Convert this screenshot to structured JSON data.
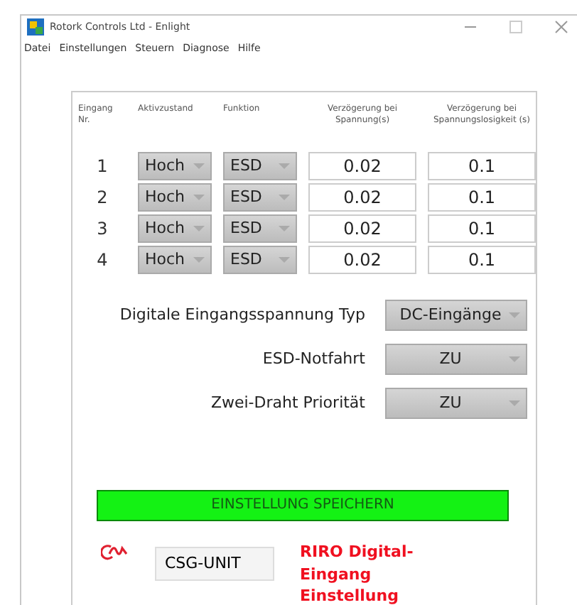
{
  "window": {
    "title": "Rotork Controls Ltd - Enlight"
  },
  "menu": [
    "Datei",
    "Einstellungen",
    "Steuern",
    "Diagnose",
    "Hilfe"
  ],
  "table": {
    "columns": [
      "Eingang Nr.",
      "Aktivzustand",
      "Funktion",
      "Verzögerung bei Spannung(s)",
      "Verzögerung bei Spannungslosigkeit (s)"
    ],
    "rows": [
      {
        "number": "1",
        "state": "Hoch",
        "function": "ESD",
        "delay_on": "0.02",
        "delay_off": "0.1"
      },
      {
        "number": "2",
        "state": "Hoch",
        "function": "ESD",
        "delay_on": "0.02",
        "delay_off": "0.1"
      },
      {
        "number": "3",
        "state": "Hoch",
        "function": "ESD",
        "delay_on": "0.02",
        "delay_off": "0.1"
      },
      {
        "number": "4",
        "state": "Hoch",
        "function": "ESD",
        "delay_on": "0.02",
        "delay_off": "0.1"
      }
    ]
  },
  "settings": [
    {
      "label": "Digitale Eingangsspannung Typ",
      "value": "DC-Eingänge"
    },
    {
      "label": "ESD-Notfahrt",
      "value": "ZU"
    },
    {
      "label": "Zwei-Draht Priorität",
      "value": "ZU"
    }
  ],
  "save_button": "EINSTELLUNG SPEICHERN",
  "unit_field": {
    "value": "CSG-UNIT"
  },
  "caption": "RIRO Digital-Eingang Einstellung"
}
